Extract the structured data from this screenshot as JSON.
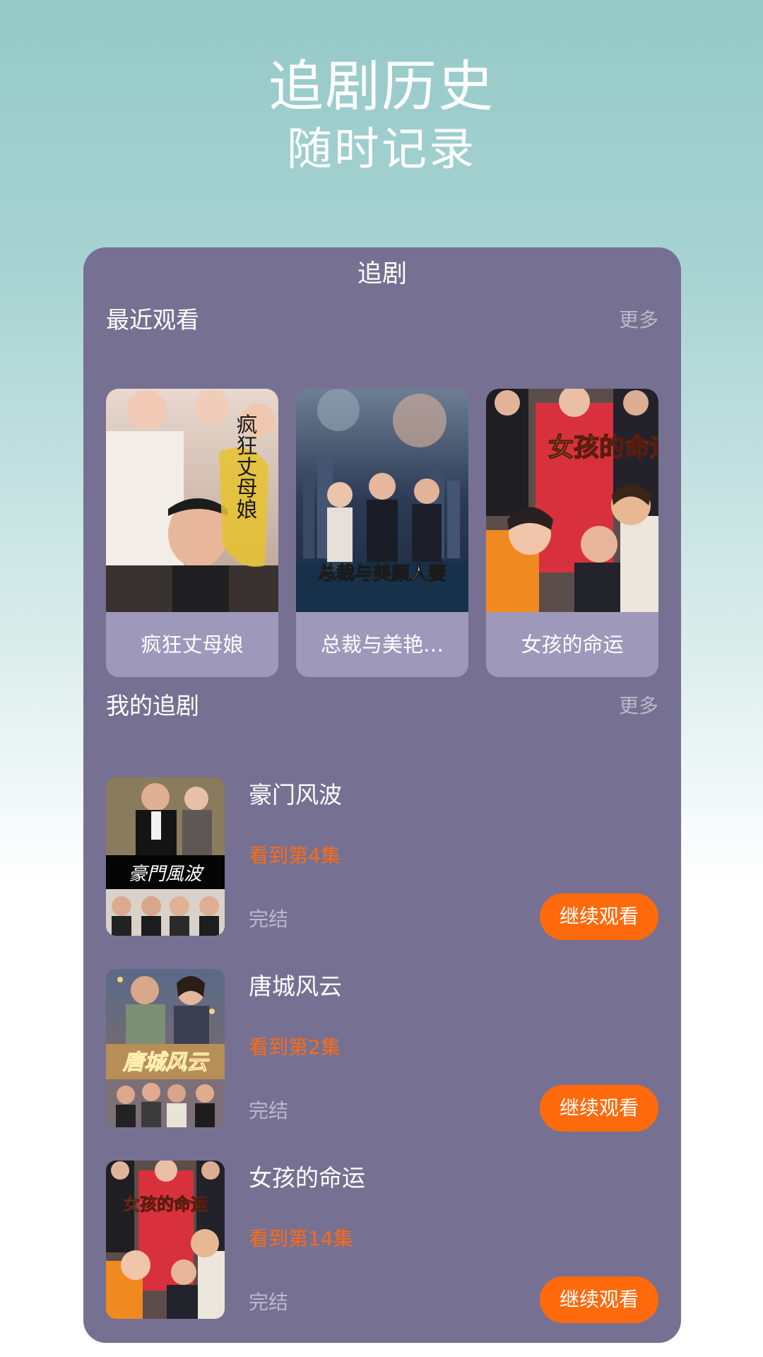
{
  "hero": {
    "title": "追剧历史",
    "subtitle": "随时记录"
  },
  "panel": {
    "title": "追剧"
  },
  "recent": {
    "section_title": "最近观看",
    "more_label": "更多",
    "items": [
      {
        "title": "疯狂丈母娘",
        "cover_text": "疯狂丈母娘"
      },
      {
        "title": "总裁与美艳…",
        "cover_text": "总裁与美颜人妻"
      },
      {
        "title": "女孩的命运",
        "cover_text": "女孩的命运"
      }
    ]
  },
  "my_dramas": {
    "section_title": "我的追剧",
    "more_label": "更多",
    "items": [
      {
        "title": "豪门风波",
        "progress": "看到第4集",
        "status": "完结",
        "button": "继续观看",
        "cover_text": "豪門風波"
      },
      {
        "title": "唐城风云",
        "progress": "看到第2集",
        "status": "完结",
        "button": "继续观看",
        "cover_text": "唐城风云"
      },
      {
        "title": "女孩的命运",
        "progress": "看到第14集",
        "status": "完结",
        "button": "继续观看",
        "cover_text": "女孩的命运"
      }
    ]
  },
  "colors": {
    "panel": "#767192",
    "card": "#9e99bb",
    "accent": "#ff6a0d",
    "progress_text": "#ff6a14"
  }
}
